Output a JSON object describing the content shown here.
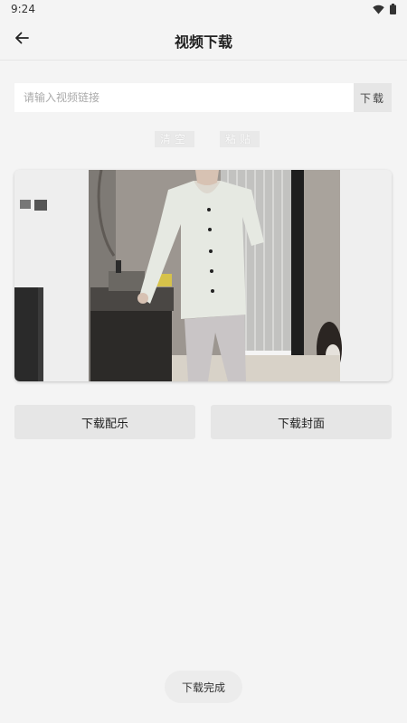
{
  "status_bar": {
    "time": "9:24",
    "wifi_icon": "wifi-icon",
    "battery_icon": "battery-icon"
  },
  "header": {
    "back_icon": "arrow-left-icon",
    "title": "视频下载"
  },
  "url_input": {
    "placeholder": "请输入视频链接",
    "value": "",
    "download_label": "下载"
  },
  "actions": {
    "clear_label": "清空",
    "paste_label": "粘贴"
  },
  "video": {
    "preview_icon": "video-thumbnail"
  },
  "buttons": {
    "download_music_label": "下载配乐",
    "download_cover_label": "下载封面"
  },
  "toast": {
    "message": "下载完成"
  },
  "colors": {
    "background": "#f4f4f4",
    "button_bg": "#e6e6e6",
    "text": "#222222",
    "placeholder": "#aaaaaa"
  }
}
